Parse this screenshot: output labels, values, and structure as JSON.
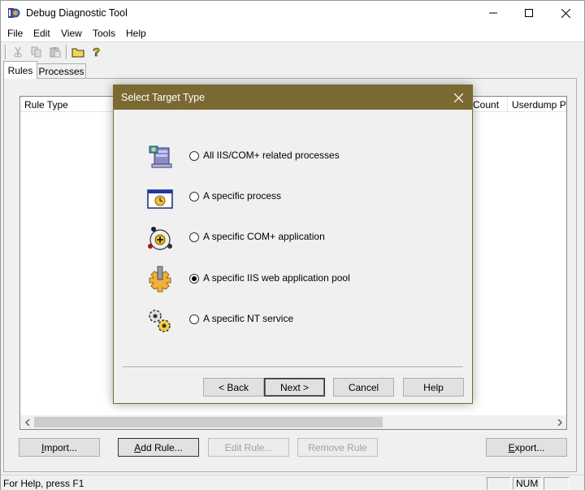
{
  "window": {
    "title": "Debug Diagnostic Tool"
  },
  "menu": [
    "File",
    "Edit",
    "View",
    "Tools",
    "Help"
  ],
  "toolbar": {
    "buttons": [
      "cut-icon",
      "copy-icon",
      "paste-icon",
      "open-folder-icon",
      "help-icon"
    ]
  },
  "tabs": [
    {
      "label": "Rules",
      "selected": true
    },
    {
      "label": "Processes",
      "selected": false
    }
  ],
  "list": {
    "columns": [
      "Rule Type",
      "Count",
      "Userdump Pat"
    ]
  },
  "buttons": {
    "import": {
      "label": "Import...",
      "underline": "I",
      "rest": "mport..."
    },
    "add_rule": {
      "label": "Add Rule...",
      "underline": "A",
      "rest": "dd Rule..."
    },
    "edit_rule": {
      "label": "Edit Rule..."
    },
    "remove_rule": {
      "label": "Remove Rule"
    },
    "export": {
      "label": "Export...",
      "underline": "E",
      "rest": "xport..."
    }
  },
  "status": {
    "text": "For Help, press F1",
    "num": "NUM"
  },
  "dialog": {
    "title": "Select Target Type",
    "title_color": "#7a6a32",
    "options": [
      {
        "label": "All IIS/COM+ related processes",
        "icon": "server-computer-icon",
        "checked": false
      },
      {
        "label": "A specific process",
        "icon": "process-window-icon",
        "checked": false
      },
      {
        "label": "A specific COM+ application",
        "icon": "com-plus-icon",
        "checked": false
      },
      {
        "label": "A specific IIS web application pool",
        "icon": "iis-gear-icon",
        "checked": true
      },
      {
        "label": "A specific NT service",
        "icon": "nt-service-gears-icon",
        "checked": false
      }
    ],
    "buttons": {
      "back": "< Back",
      "next": "Next >",
      "cancel": "Cancel",
      "help": "Help"
    }
  }
}
